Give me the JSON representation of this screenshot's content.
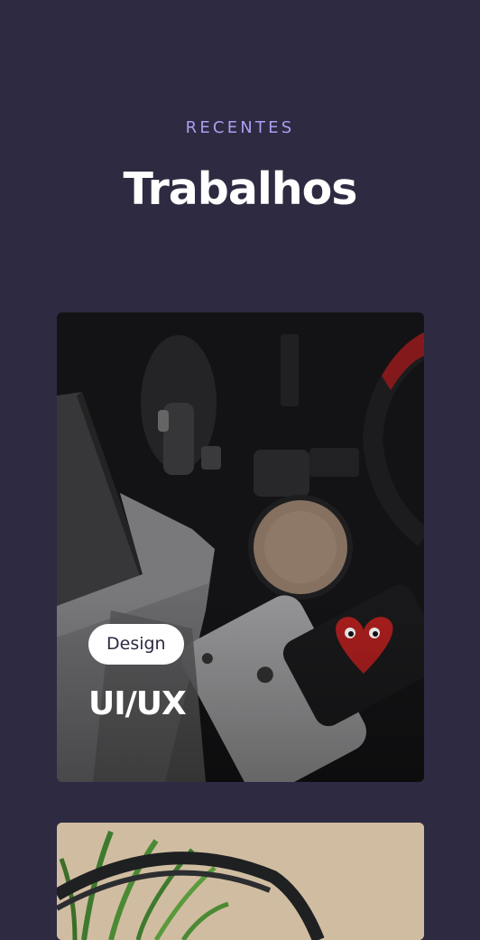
{
  "section": {
    "kicker": "RECENTES",
    "title": "Trabalhos"
  },
  "cards": [
    {
      "tag": "Design",
      "title": "UI/UX"
    },
    {
      "tag": "",
      "title": ""
    }
  ],
  "colors": {
    "background": "#2e2a41",
    "accent": "#a99ff0",
    "tag_bg": "#ffffff",
    "tag_text": "#2e2a41"
  }
}
